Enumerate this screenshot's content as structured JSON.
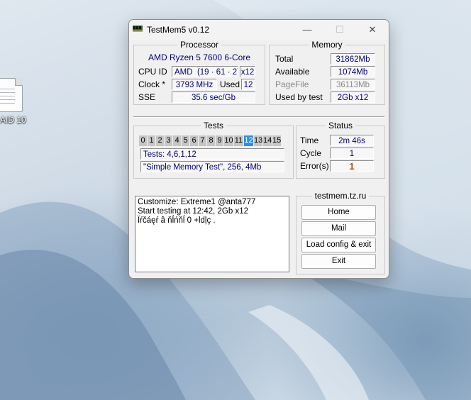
{
  "desktop": {
    "icon_label": "AID 10"
  },
  "window": {
    "title": "TestMem5 v0.12",
    "controls": {
      "minimize": "—",
      "maximize": "☐",
      "close": "✕"
    }
  },
  "processor": {
    "group_title": "Processor",
    "name": "AMD Ryzen 5 7600 6-Core",
    "cpu_id_label": "CPU ID",
    "cpu_vendor": "AMD",
    "cpu_signature": "(19 · 61 · 2)",
    "threads": "x12",
    "clock_label": "Clock *",
    "clock_value": "3793 MHz",
    "used_label": "Used",
    "used_value": "12",
    "sse_label": "SSE",
    "sse_value": "35.6 sec/Gb"
  },
  "memory": {
    "group_title": "Memory",
    "total_label": "Total",
    "total_value": "31862Mb",
    "available_label": "Available",
    "available_value": "1074Mb",
    "pagefile_label": "PageFile",
    "pagefile_value": "36113Mb",
    "used_by_test_label": "Used by test",
    "used_by_test_value": "2Gb x12"
  },
  "tests": {
    "group_title": "Tests",
    "cells": [
      "0",
      "1",
      "2",
      "3",
      "4",
      "5",
      "6",
      "7",
      "8",
      "9",
      "10",
      "11",
      "12",
      "13",
      "14",
      "15"
    ],
    "active_cell": "12",
    "sequence": "Tests: 4,6,1,12",
    "current": "\"Simple Memory Test\", 256, 4Mb"
  },
  "status": {
    "group_title": "Status",
    "time_label": "Time",
    "time_value": "2m 46s",
    "cycle_label": "Cycle",
    "cycle_value": "1",
    "errors_label": "Error(s)",
    "errors_value": "1"
  },
  "log": {
    "lines": [
      "Customize: Extreme1 @anta777",
      "Start testing at 12:42, 2Gb x12",
      "Ïŕčáęŕ â ňĺńňĺ 0 +ldļç ."
    ]
  },
  "links": {
    "group_title": "testmem.tz.ru",
    "home": "Home",
    "mail": "Mail",
    "load_config": "Load config & exit",
    "exit": "Exit"
  },
  "colors": {
    "active_cell": "#2f8fe0",
    "field_text": "#00007a",
    "error_text": "#b34a00"
  }
}
